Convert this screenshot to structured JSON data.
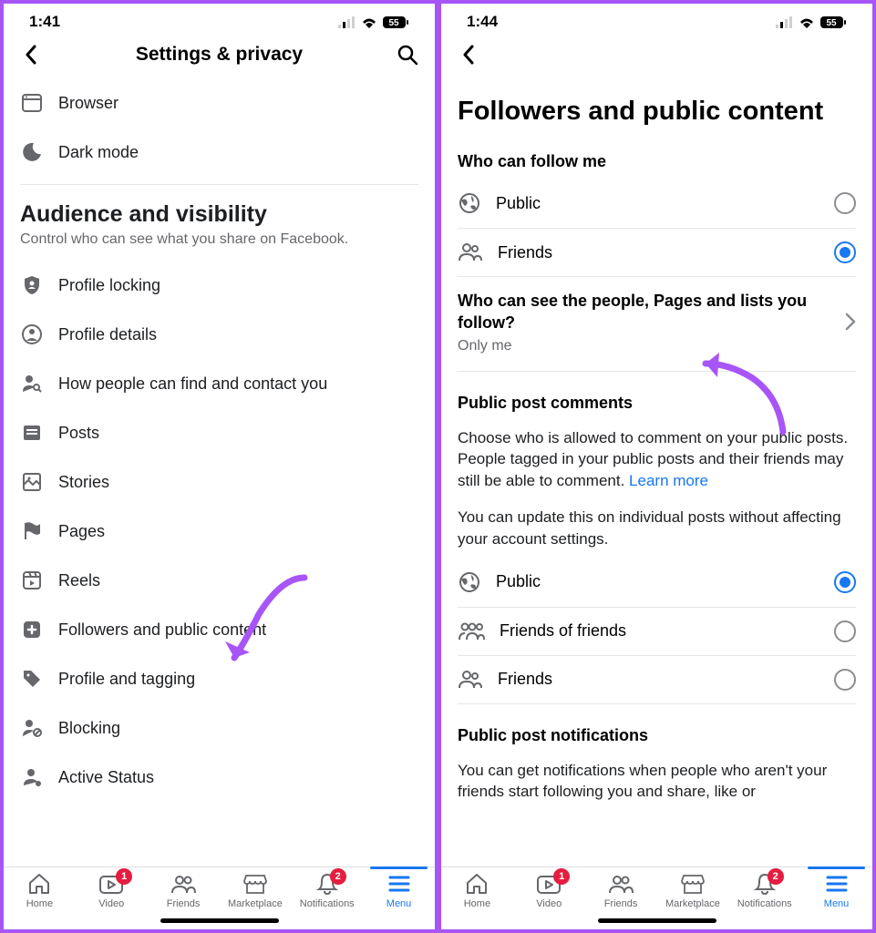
{
  "left": {
    "status": {
      "time": "1:41",
      "battery": "55"
    },
    "header": {
      "title": "Settings & privacy"
    },
    "top_rows": [
      {
        "label": "Browser"
      },
      {
        "label": "Dark mode"
      }
    ],
    "section": {
      "title": "Audience and visibility",
      "subtitle": "Control who can see what you share on Facebook."
    },
    "items": [
      {
        "label": "Profile locking"
      },
      {
        "label": "Profile details"
      },
      {
        "label": "How people can find and contact you"
      },
      {
        "label": "Posts"
      },
      {
        "label": "Stories"
      },
      {
        "label": "Pages"
      },
      {
        "label": "Reels"
      },
      {
        "label": "Followers and public content"
      },
      {
        "label": "Profile and tagging"
      },
      {
        "label": "Blocking"
      },
      {
        "label": "Active Status"
      }
    ]
  },
  "right": {
    "status": {
      "time": "1:44",
      "battery": "55"
    },
    "page_title": "Followers and public content",
    "follow_heading": "Who can follow me",
    "follow_options": [
      {
        "label": "Public",
        "selected": false
      },
      {
        "label": "Friends",
        "selected": true
      }
    ],
    "who_can_see": {
      "question": "Who can see the people, Pages and lists you follow?",
      "value": "Only me"
    },
    "comments": {
      "heading": "Public post comments",
      "para1": "Choose who is allowed to comment on your public posts. People tagged in your public posts and their friends may still be able to comment.",
      "learn_more": "Learn more",
      "para2": "You can update this on individual posts without affecting your account settings.",
      "options": [
        {
          "label": "Public",
          "selected": true
        },
        {
          "label": "Friends of friends",
          "selected": false
        },
        {
          "label": "Friends",
          "selected": false
        }
      ]
    },
    "notifications": {
      "heading": "Public post notifications",
      "para": "You can get notifications when people who aren't your friends start following you and share, like or"
    }
  },
  "tabs": [
    {
      "name": "Home"
    },
    {
      "name": "Video",
      "badge": "1"
    },
    {
      "name": "Friends"
    },
    {
      "name": "Marketplace"
    },
    {
      "name": "Notifications",
      "badge": "2"
    },
    {
      "name": "Menu",
      "active": true
    }
  ]
}
